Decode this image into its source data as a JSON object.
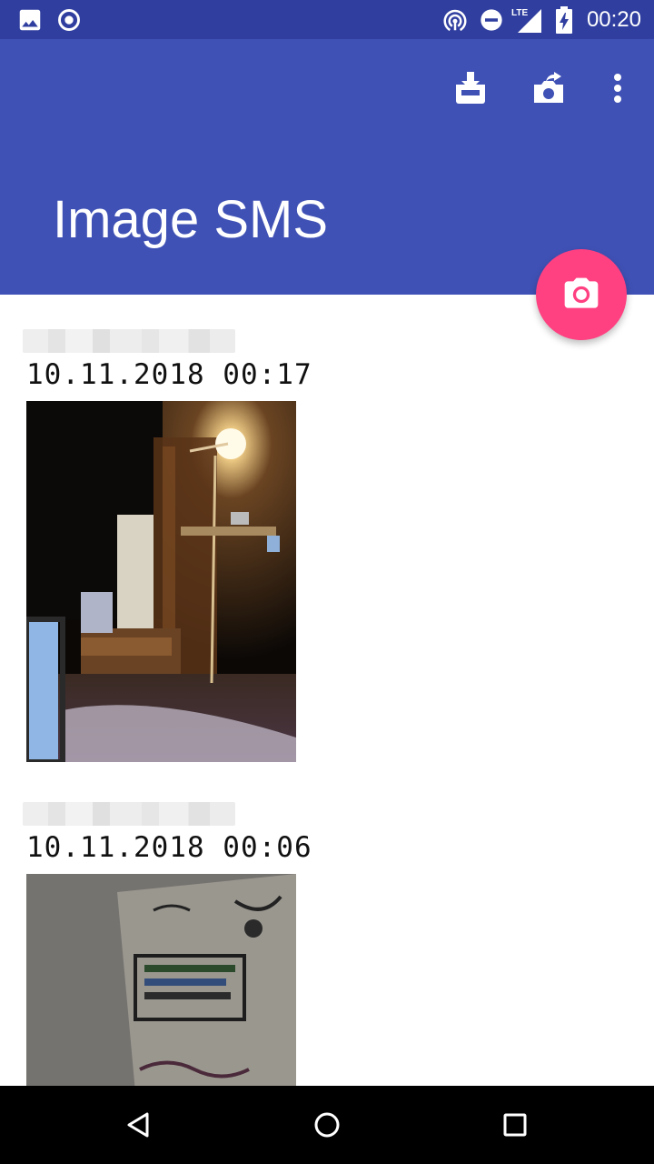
{
  "status_bar": {
    "time": "00:20",
    "network": "LTE",
    "icons": [
      "image-notification-icon",
      "record-notification-icon",
      "hotspot-icon",
      "do-not-disturb-icon",
      "signal-icon",
      "battery-charging-icon"
    ]
  },
  "app_bar": {
    "title": "Image SMS",
    "actions": [
      "download-inbox-icon",
      "camera-share-icon",
      "more-vert-icon"
    ],
    "colors": {
      "primary": "#3f51b5",
      "primary_dark": "#303f9f",
      "accent": "#ff4081"
    }
  },
  "fab": {
    "icon": "camera-icon"
  },
  "messages": [
    {
      "timestamp": "10.11.2018 00:17",
      "sender": "",
      "image": "photo-lamp-room"
    },
    {
      "timestamp": "10.11.2018 00:06",
      "sender": "",
      "image": "photo-whiteboard-drawing"
    }
  ],
  "nav_bar": {
    "buttons": [
      "back-icon",
      "home-icon",
      "recents-icon"
    ]
  }
}
